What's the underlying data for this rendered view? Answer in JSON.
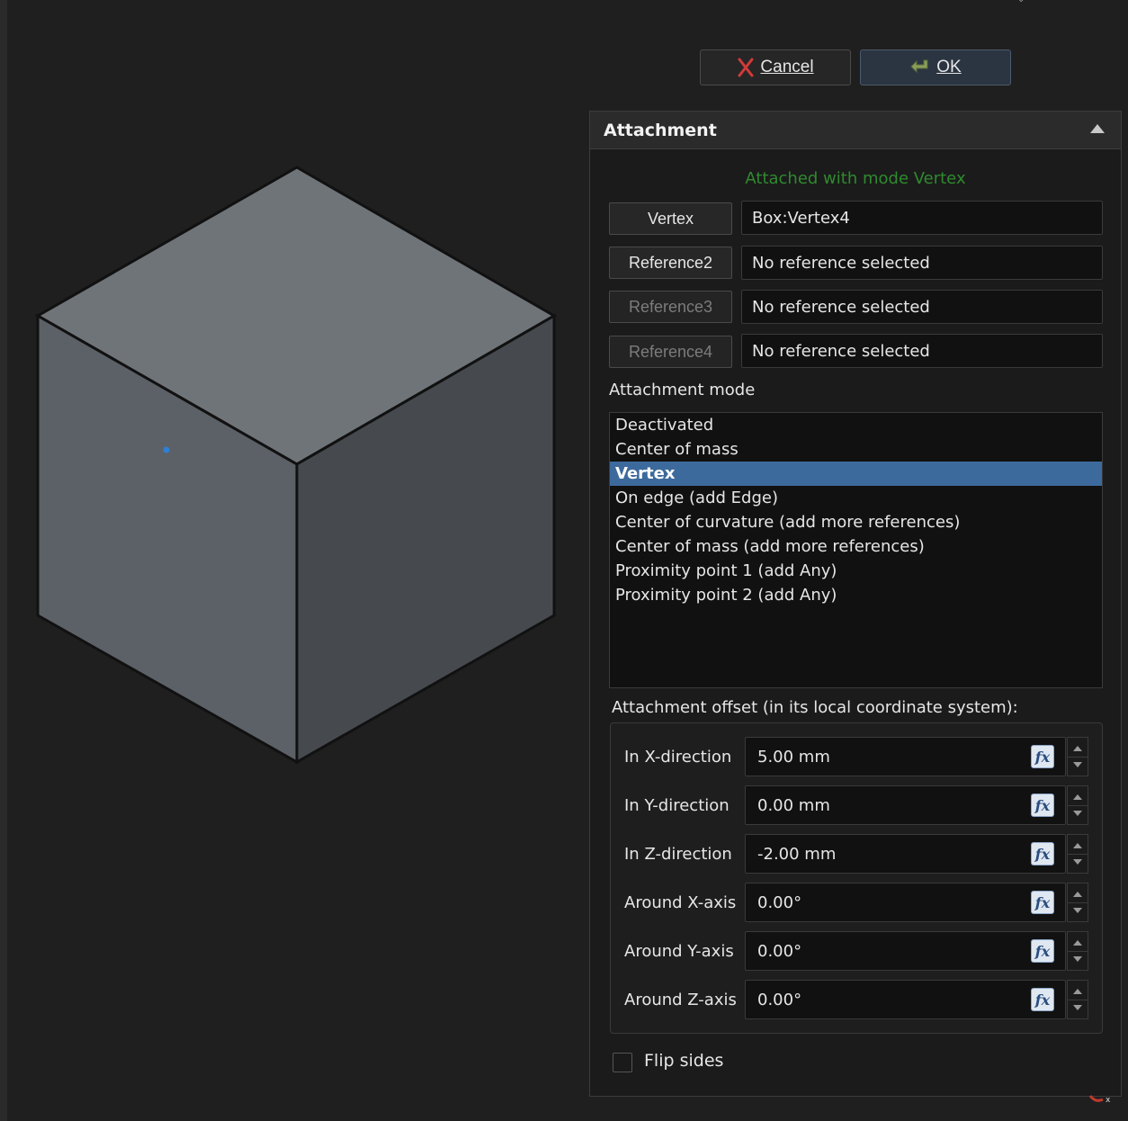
{
  "dialog": {
    "cancel_label": "Cancel",
    "ok_label": "OK"
  },
  "attachment": {
    "title": "Attachment",
    "status": "Attached with mode Vertex",
    "references": [
      {
        "button": "Vertex",
        "value": "Box:Vertex4",
        "enabled": true
      },
      {
        "button": "Reference2",
        "value": "No reference selected",
        "enabled": true
      },
      {
        "button": "Reference3",
        "value": "No reference selected",
        "enabled": false
      },
      {
        "button": "Reference4",
        "value": "No reference selected",
        "enabled": false
      }
    ],
    "mode_label": "Attachment mode",
    "modes": [
      "Deactivated",
      "Center of mass",
      "Vertex",
      "On edge (add Edge)",
      "Center of curvature (add more references)",
      "Center of mass (add more references)",
      "Proximity point 1 (add Any)",
      "Proximity point 2 (add Any)"
    ],
    "selected_mode": "Vertex",
    "offset_label": "Attachment offset (in its local coordinate system):",
    "offsets": [
      {
        "label": "In X-direction",
        "value": "5.00 mm"
      },
      {
        "label": "In Y-direction",
        "value": "0.00 mm"
      },
      {
        "label": "In Z-direction",
        "value": "-2.00 mm"
      },
      {
        "label": "Around X-axis",
        "value": "0.00°"
      },
      {
        "label": "Around Y-axis",
        "value": "0.00°"
      },
      {
        "label": "Around Z-axis",
        "value": "0.00°"
      }
    ],
    "flip_label": "Flip sides",
    "flip_checked": false
  },
  "icons": {
    "cancel": "close-x-icon",
    "ok": "ok-arrow-icon",
    "collapse": "collapse-up-icon",
    "expression": "fx-icon"
  },
  "colors": {
    "status_green": "#2f8a2f",
    "selection_blue": "#3d6a9c",
    "cube_top": "#6f7479",
    "cube_left": "#5c6167",
    "cube_right": "#464a4f"
  }
}
